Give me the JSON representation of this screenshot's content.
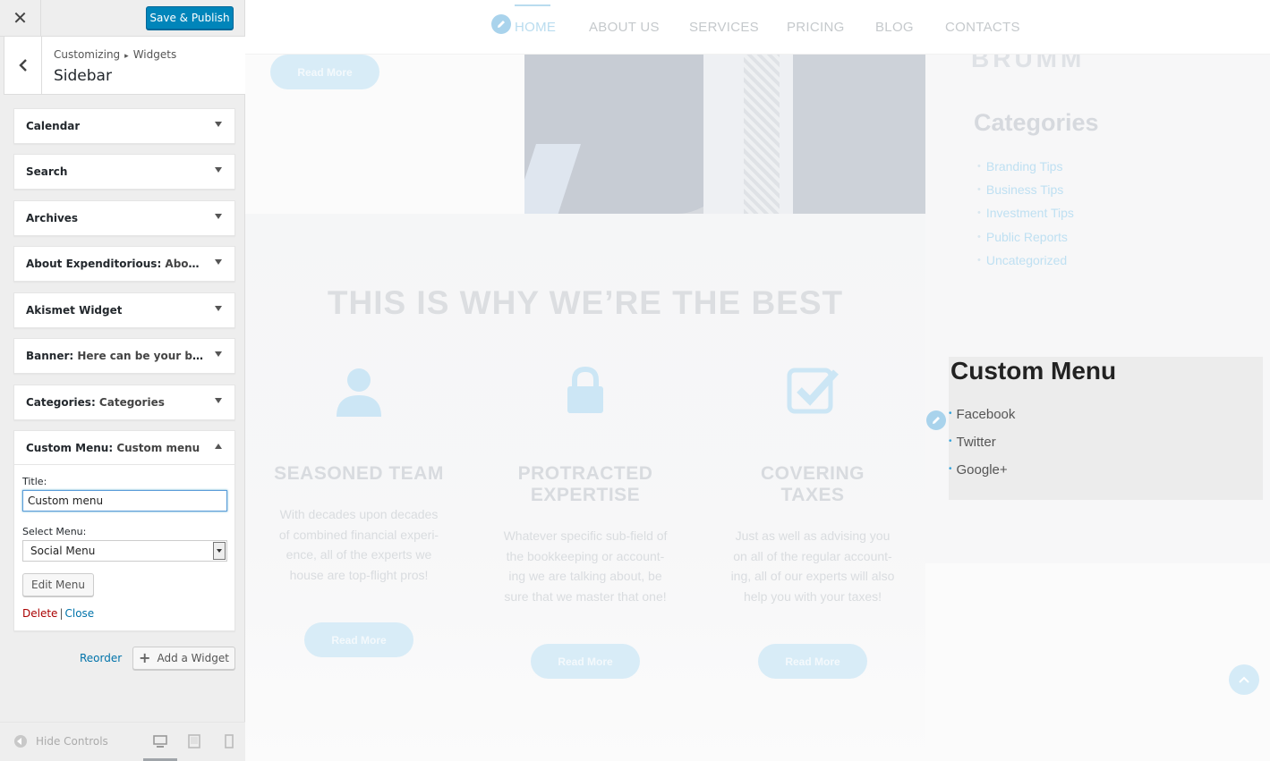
{
  "customizer": {
    "save_label": "Save & Publish",
    "breadcrumb": [
      "Customizing",
      "Widgets"
    ],
    "section_title": "Sidebar",
    "widgets": [
      {
        "name": "Calendar",
        "instance": ""
      },
      {
        "name": "Search",
        "instance": ""
      },
      {
        "name": "Archives",
        "instance": ""
      },
      {
        "name": "About Expenditorious",
        "instance": "About Ex..."
      },
      {
        "name": "Akismet Widget",
        "instance": ""
      },
      {
        "name": "Banner",
        "instance": "Here can be your banner"
      },
      {
        "name": "Categories",
        "instance": "Categories"
      }
    ],
    "open_widget": {
      "name": "Custom Menu",
      "instance": "Custom menu",
      "title_label": "Title:",
      "title_value": "Custom menu",
      "select_label": "Select Menu:",
      "select_value": "Social Menu",
      "edit_button": "Edit Menu",
      "delete_label": "Delete",
      "close_label": "Close"
    },
    "reorder_label": "Reorder",
    "add_widget_label": "Add a Widget",
    "hide_controls_label": "Hide Controls"
  },
  "preview": {
    "nav": [
      "HOME",
      "ABOUT US",
      "SERVICES",
      "PRICING",
      "BLOG",
      "CONTACTS"
    ],
    "brand_partial": "BRUMM",
    "read_more_label": "Read More",
    "categories_title": "Categories",
    "categories": [
      "Branding Tips",
      "Business Tips",
      "Investment Tips",
      "Public Reports",
      "Uncategorized"
    ],
    "headline": "THIS IS WHY WE’RE THE BEST",
    "features": [
      {
        "title_lines": [
          "SEASONED TEAM"
        ],
        "text_lines": [
          "With decades upon decades",
          "of combined financial experi-",
          "ence, all of the experts we",
          "house are top-flight pros!"
        ],
        "icon": "user-icon"
      },
      {
        "title_lines": [
          "PROTRACTED",
          "EXPERTISE"
        ],
        "text_lines": [
          "Whatever specific sub-field of",
          "the bookkeeping or account-",
          "ing we are talking about, be",
          "sure that we master that one!"
        ],
        "icon": "lock-icon"
      },
      {
        "title_lines": [
          "COVERING",
          "TAXES"
        ],
        "text_lines": [
          "Just as well as advising you",
          "on all of the regular account-",
          "ing, all of our experts will also",
          "help you with your taxes!"
        ],
        "icon": "checkbox-icon"
      }
    ],
    "custom_menu": {
      "title": "Custom Menu",
      "items": [
        "Facebook",
        "Twitter",
        "Google+"
      ]
    }
  },
  "colors": {
    "primary_button": "#0085ba",
    "link": "#0073aa",
    "delete": "#a00000",
    "accent_faded": "#b9dcef"
  }
}
